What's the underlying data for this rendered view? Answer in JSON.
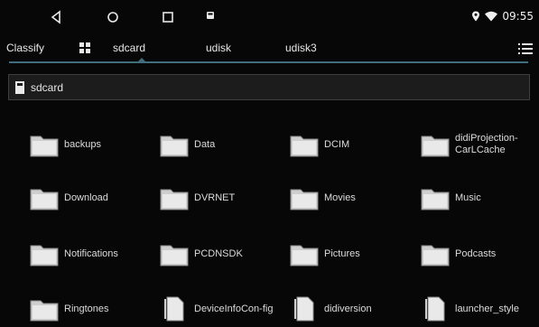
{
  "status_bar": {
    "nav_icons": [
      "back-triangle-icon",
      "home-circle-icon",
      "recents-square-icon",
      "notification-icon"
    ],
    "status_icons": [
      "location-icon",
      "wifi-icon"
    ],
    "time": "09:55"
  },
  "tabs": {
    "classify": "Classify",
    "items": [
      "sdcard",
      "udisk",
      "udisk3"
    ],
    "active": "sdcard",
    "accent_color": "#3f6d7a"
  },
  "path_bar": {
    "label": "sdcard",
    "icon": "sdcard-icon"
  },
  "files": [
    {
      "name": "backups",
      "type": "folder"
    },
    {
      "name": "Data",
      "type": "folder"
    },
    {
      "name": "DCIM",
      "type": "folder"
    },
    {
      "name": "didiProjection-CarLCache",
      "type": "folder"
    },
    {
      "name": "Download",
      "type": "folder"
    },
    {
      "name": "DVRNET",
      "type": "folder"
    },
    {
      "name": "Movies",
      "type": "folder"
    },
    {
      "name": "Music",
      "type": "folder"
    },
    {
      "name": "Notifications",
      "type": "folder"
    },
    {
      "name": "PCDNSDK",
      "type": "folder"
    },
    {
      "name": "Pictures",
      "type": "folder"
    },
    {
      "name": "Podcasts",
      "type": "folder"
    },
    {
      "name": "Ringtones",
      "type": "folder"
    },
    {
      "name": "DeviceInfoCon-fig",
      "type": "file"
    },
    {
      "name": "didiversion",
      "type": "file"
    },
    {
      "name": "launcher_style",
      "type": "file"
    }
  ]
}
